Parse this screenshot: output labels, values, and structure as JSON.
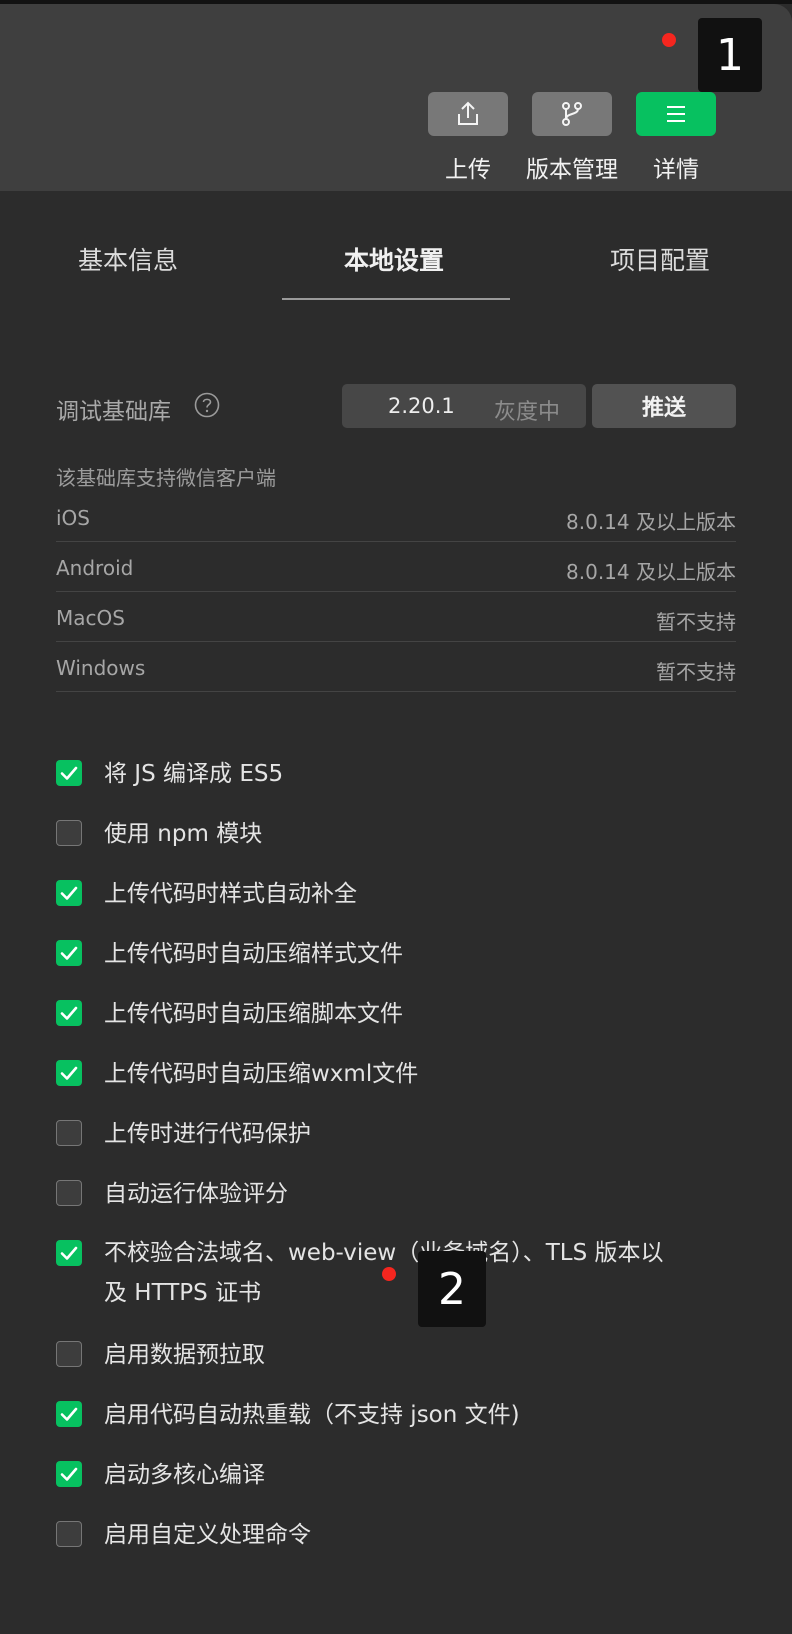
{
  "toolbar": {
    "buttons": [
      {
        "label": "上传",
        "icon": "upload-icon"
      },
      {
        "label": "版本管理",
        "icon": "branch-icon"
      },
      {
        "label": "详情",
        "icon": "menu-icon",
        "active": true
      }
    ]
  },
  "markers": {
    "one": "1",
    "two": "2"
  },
  "tabs": [
    "基本信息",
    "本地设置",
    "项目配置"
  ],
  "active_tab": "本地设置",
  "debug_lib": {
    "title": "调试基础库",
    "version": "2.20.1",
    "state": "灰度中",
    "push_label": "推送"
  },
  "support": {
    "title": "该基础库支持微信客户端",
    "rows": [
      {
        "os": "iOS",
        "ver": "8.0.14 及以上版本"
      },
      {
        "os": "Android",
        "ver": "8.0.14 及以上版本"
      },
      {
        "os": "MacOS",
        "ver": "暂不支持"
      },
      {
        "os": "Windows",
        "ver": "暂不支持"
      }
    ]
  },
  "options": [
    {
      "label": "将 JS 编译成 ES5",
      "checked": true
    },
    {
      "label": "使用 npm 模块",
      "checked": false
    },
    {
      "label": "上传代码时样式自动补全",
      "checked": true
    },
    {
      "label": "上传代码时自动压缩样式文件",
      "checked": true
    },
    {
      "label": "上传代码时自动压缩脚本文件",
      "checked": true
    },
    {
      "label": "上传代码时自动压缩wxml文件",
      "checked": true
    },
    {
      "label": "上传时进行代码保护",
      "checked": false
    },
    {
      "label": "自动运行体验评分",
      "checked": false
    },
    {
      "label": "不校验合法域名、web-view（业务域名）、TLS 版本以及 HTTPS 证书",
      "checked": true
    },
    {
      "label": "启用数据预拉取",
      "checked": false
    },
    {
      "label": "启用代码自动热重载（不支持 json 文件)",
      "checked": true
    },
    {
      "label": "启动多核心编译",
      "checked": true
    },
    {
      "label": "启用自定义处理命令",
      "checked": false
    }
  ],
  "colors": {
    "accent": "#07c160",
    "marker_dot": "#f5261f"
  }
}
